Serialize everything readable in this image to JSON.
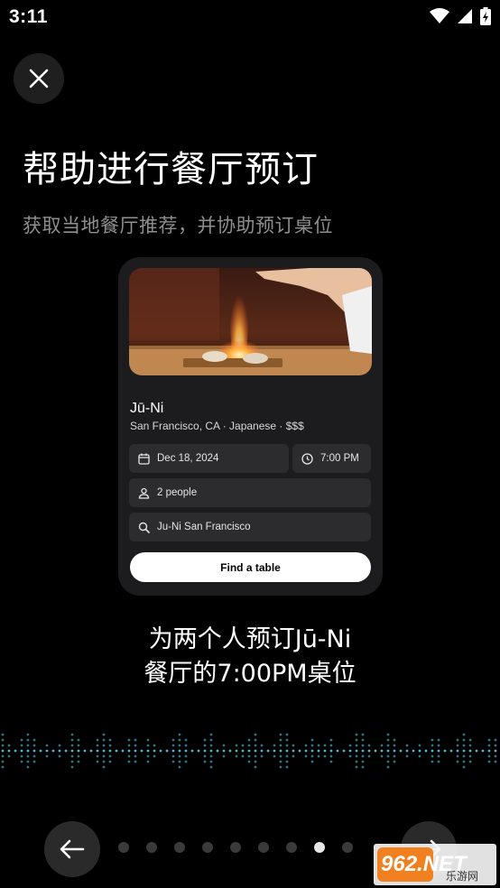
{
  "status_bar": {
    "time": "3:11"
  },
  "header": {
    "title": "帮助进行餐厅预订",
    "subtitle": "获取当地餐厅推荐，并协助预订桌位"
  },
  "card": {
    "restaurant_name": "Jū-Ni",
    "restaurant_meta": "San Francisco, CA · Japanese · $$$",
    "date": "Dec 18, 2024",
    "time": "7:00 PM",
    "party_size": "2 people",
    "search_query": "Ju-Ni San Francisco",
    "button_label": "Find a table"
  },
  "caption": {
    "line1": "为两个人预订Jū-Ni",
    "line2": "餐厅的7:00PM桌位"
  },
  "pagination": {
    "total": 9,
    "active_index": 7
  },
  "watermark": {
    "text": "962.NET",
    "subtext": "乐游网"
  },
  "colors": {
    "background": "#000000",
    "card": "#1c1c1e",
    "field": "#2c2c2e",
    "wave": "#4fc3e0"
  }
}
